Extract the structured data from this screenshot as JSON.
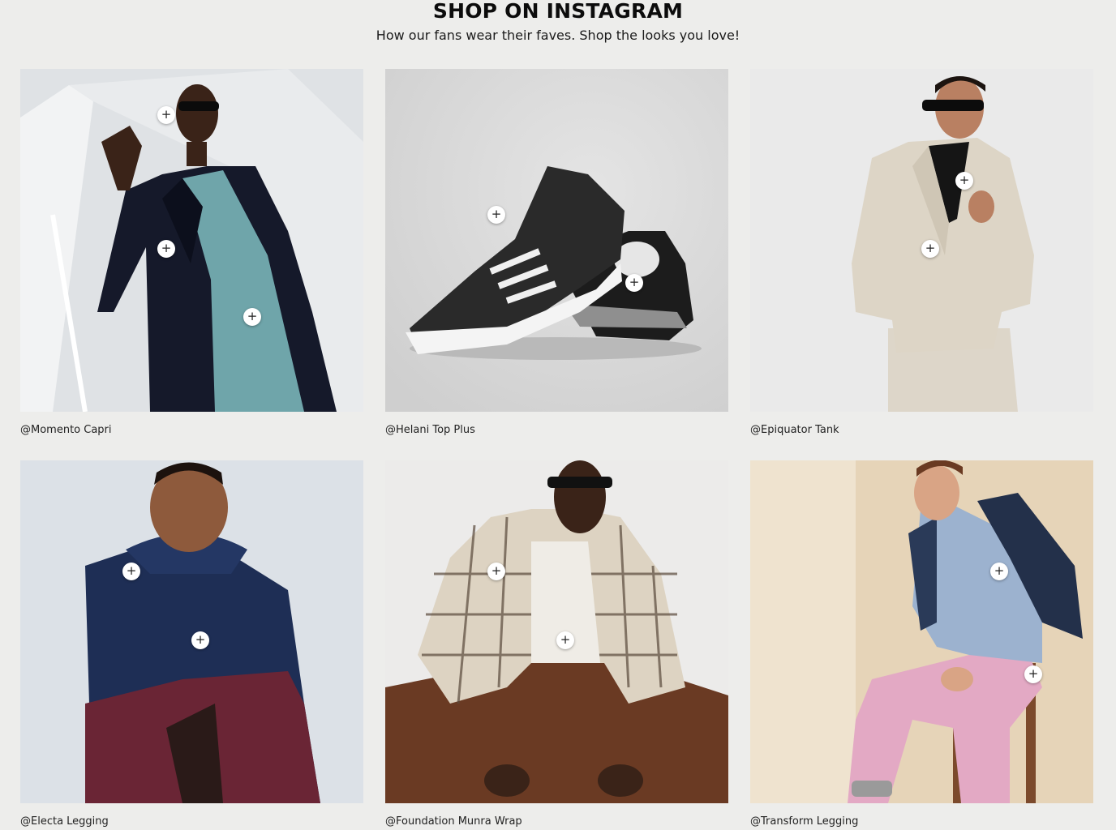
{
  "header": {
    "title": "SHOP ON INSTAGRAM",
    "subtitle": "How our fans wear their faves. Shop the looks you love!"
  },
  "hotspot_icon": "plus-icon",
  "cards": [
    {
      "caption": "@Momento Capri",
      "bg": "#e4e6e8"
    },
    {
      "caption": "@Helani Top Plus",
      "bg": "#d9d9d9"
    },
    {
      "caption": "@Epiquator Tank",
      "bg": "#e8e8e8"
    },
    {
      "caption": "@Electa Legging",
      "bg": "#d8dde3"
    },
    {
      "caption": "@Foundation Munra Wrap",
      "bg": "#ecebea"
    },
    {
      "caption": "@Transform Legging",
      "bg": "#e8d8bf"
    }
  ]
}
